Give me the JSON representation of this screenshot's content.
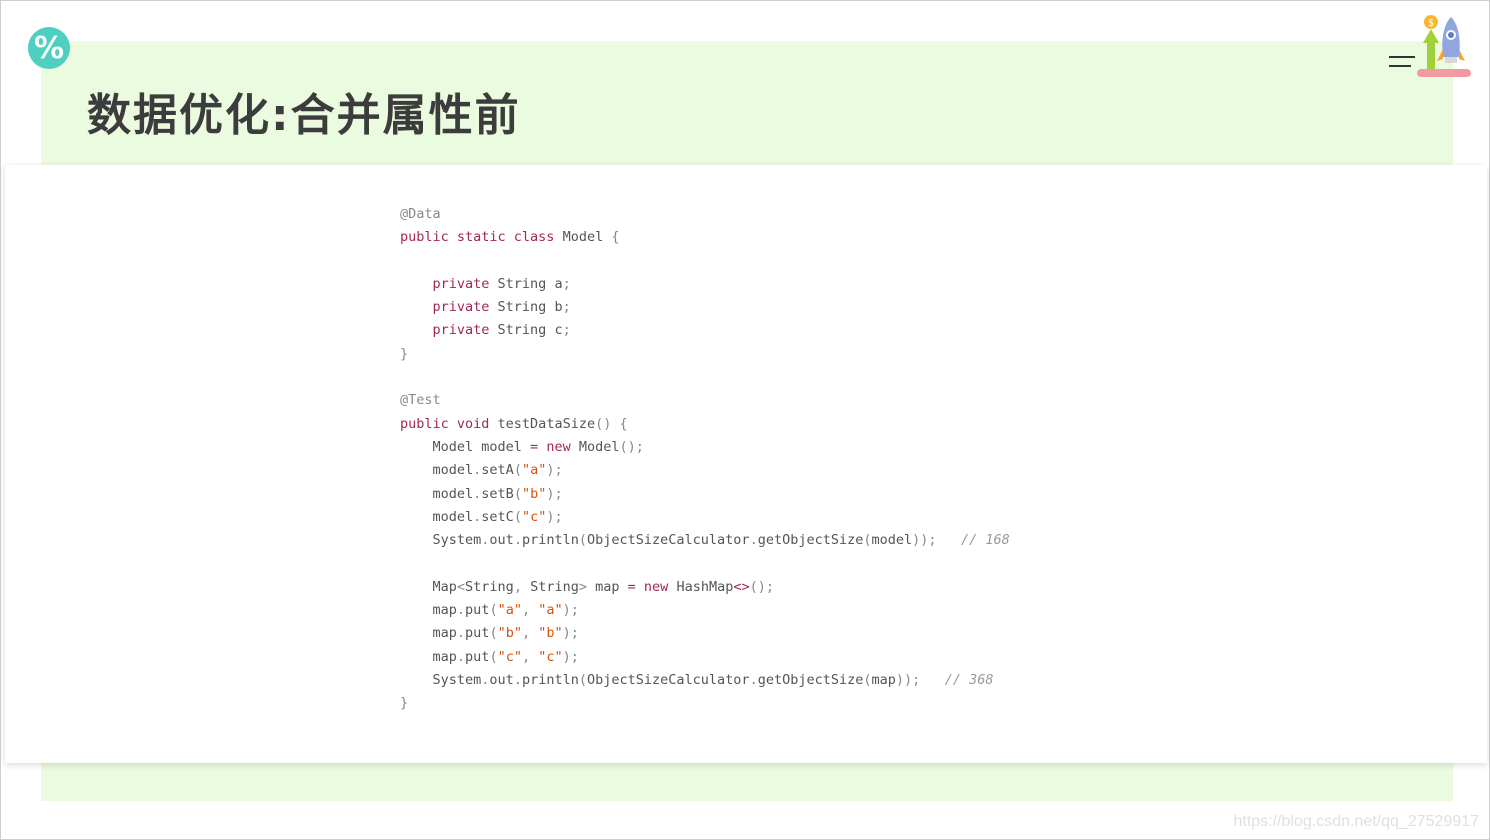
{
  "slide": {
    "badge_symbol": "%",
    "title": "数据优化:合并属性前"
  },
  "code_lines": [
    [
      {
        "t": "@Data",
        "c": "ann"
      }
    ],
    [
      {
        "t": "public static class ",
        "c": "kw"
      },
      {
        "t": "Model ",
        "c": "id"
      },
      {
        "t": "{",
        "c": "punc"
      }
    ],
    [],
    [
      {
        "t": "    private ",
        "c": "kw"
      },
      {
        "t": "String a",
        "c": "id"
      },
      {
        "t": ";",
        "c": "punc"
      }
    ],
    [
      {
        "t": "    private ",
        "c": "kw"
      },
      {
        "t": "String b",
        "c": "id"
      },
      {
        "t": ";",
        "c": "punc"
      }
    ],
    [
      {
        "t": "    private ",
        "c": "kw"
      },
      {
        "t": "String c",
        "c": "id"
      },
      {
        "t": ";",
        "c": "punc"
      }
    ],
    [
      {
        "t": "}",
        "c": "punc"
      }
    ],
    [],
    [
      {
        "t": "@Test",
        "c": "ann"
      }
    ],
    [
      {
        "t": "public void ",
        "c": "kw"
      },
      {
        "t": "testDataSize",
        "c": "id"
      },
      {
        "t": "() {",
        "c": "punc"
      }
    ],
    [
      {
        "t": "    Model model ",
        "c": "id"
      },
      {
        "t": "= ",
        "c": "kw"
      },
      {
        "t": "new ",
        "c": "kw"
      },
      {
        "t": "Model",
        "c": "id"
      },
      {
        "t": "();",
        "c": "punc"
      }
    ],
    [
      {
        "t": "    model",
        "c": "id"
      },
      {
        "t": ".",
        "c": "punc"
      },
      {
        "t": "setA",
        "c": "id"
      },
      {
        "t": "(",
        "c": "punc"
      },
      {
        "t": "\"a\"",
        "c": "str"
      },
      {
        "t": ");",
        "c": "punc"
      }
    ],
    [
      {
        "t": "    model",
        "c": "id"
      },
      {
        "t": ".",
        "c": "punc"
      },
      {
        "t": "setB",
        "c": "id"
      },
      {
        "t": "(",
        "c": "punc"
      },
      {
        "t": "\"b\"",
        "c": "str"
      },
      {
        "t": ");",
        "c": "punc"
      }
    ],
    [
      {
        "t": "    model",
        "c": "id"
      },
      {
        "t": ".",
        "c": "punc"
      },
      {
        "t": "setC",
        "c": "id"
      },
      {
        "t": "(",
        "c": "punc"
      },
      {
        "t": "\"c\"",
        "c": "str"
      },
      {
        "t": ");",
        "c": "punc"
      }
    ],
    [
      {
        "t": "    System",
        "c": "id"
      },
      {
        "t": ".",
        "c": "punc"
      },
      {
        "t": "out",
        "c": "id"
      },
      {
        "t": ".",
        "c": "punc"
      },
      {
        "t": "println",
        "c": "id"
      },
      {
        "t": "(",
        "c": "punc"
      },
      {
        "t": "ObjectSizeCalculator",
        "c": "id"
      },
      {
        "t": ".",
        "c": "punc"
      },
      {
        "t": "getObjectSize",
        "c": "id"
      },
      {
        "t": "(",
        "c": "punc"
      },
      {
        "t": "model",
        "c": "id"
      },
      {
        "t": "));   ",
        "c": "punc"
      },
      {
        "t": "// 168",
        "c": "cm"
      }
    ],
    [],
    [
      {
        "t": "    Map",
        "c": "id"
      },
      {
        "t": "<",
        "c": "punc"
      },
      {
        "t": "String",
        "c": "id"
      },
      {
        "t": ", ",
        "c": "punc"
      },
      {
        "t": "String",
        "c": "id"
      },
      {
        "t": "> ",
        "c": "punc"
      },
      {
        "t": "map ",
        "c": "id"
      },
      {
        "t": "= ",
        "c": "kw"
      },
      {
        "t": "new ",
        "c": "kw"
      },
      {
        "t": "HashMap",
        "c": "id"
      },
      {
        "t": "<>",
        "c": "kw"
      },
      {
        "t": "();",
        "c": "punc"
      }
    ],
    [
      {
        "t": "    map",
        "c": "id"
      },
      {
        "t": ".",
        "c": "punc"
      },
      {
        "t": "put",
        "c": "id"
      },
      {
        "t": "(",
        "c": "punc"
      },
      {
        "t": "\"a\"",
        "c": "str"
      },
      {
        "t": ", ",
        "c": "punc"
      },
      {
        "t": "\"a\"",
        "c": "str"
      },
      {
        "t": ");",
        "c": "punc"
      }
    ],
    [
      {
        "t": "    map",
        "c": "id"
      },
      {
        "t": ".",
        "c": "punc"
      },
      {
        "t": "put",
        "c": "id"
      },
      {
        "t": "(",
        "c": "punc"
      },
      {
        "t": "\"b\"",
        "c": "str"
      },
      {
        "t": ", ",
        "c": "punc"
      },
      {
        "t": "\"b\"",
        "c": "str"
      },
      {
        "t": ");",
        "c": "punc"
      }
    ],
    [
      {
        "t": "    map",
        "c": "id"
      },
      {
        "t": ".",
        "c": "punc"
      },
      {
        "t": "put",
        "c": "id"
      },
      {
        "t": "(",
        "c": "punc"
      },
      {
        "t": "\"c\"",
        "c": "str"
      },
      {
        "t": ", ",
        "c": "punc"
      },
      {
        "t": "\"c\"",
        "c": "str"
      },
      {
        "t": ");",
        "c": "punc"
      }
    ],
    [
      {
        "t": "    System",
        "c": "id"
      },
      {
        "t": ".",
        "c": "punc"
      },
      {
        "t": "out",
        "c": "id"
      },
      {
        "t": ".",
        "c": "punc"
      },
      {
        "t": "println",
        "c": "id"
      },
      {
        "t": "(",
        "c": "punc"
      },
      {
        "t": "ObjectSizeCalculator",
        "c": "id"
      },
      {
        "t": ".",
        "c": "punc"
      },
      {
        "t": "getObjectSize",
        "c": "id"
      },
      {
        "t": "(",
        "c": "punc"
      },
      {
        "t": "map",
        "c": "id"
      },
      {
        "t": "));   ",
        "c": "punc"
      },
      {
        "t": "// 368",
        "c": "cm"
      }
    ],
    [
      {
        "t": "}",
        "c": "punc"
      }
    ]
  ],
  "watermark": "https://blog.csdn.net/qq_27529917",
  "icons": {
    "badge": "percent-icon",
    "menu": "menu-icon",
    "rocket": "rocket-icon"
  },
  "colors": {
    "band": "#ebfbe0",
    "badge": "#4fcfc0",
    "keyword": "#a0285a",
    "string": "#d4540a",
    "comment": "#9a9a9a"
  }
}
